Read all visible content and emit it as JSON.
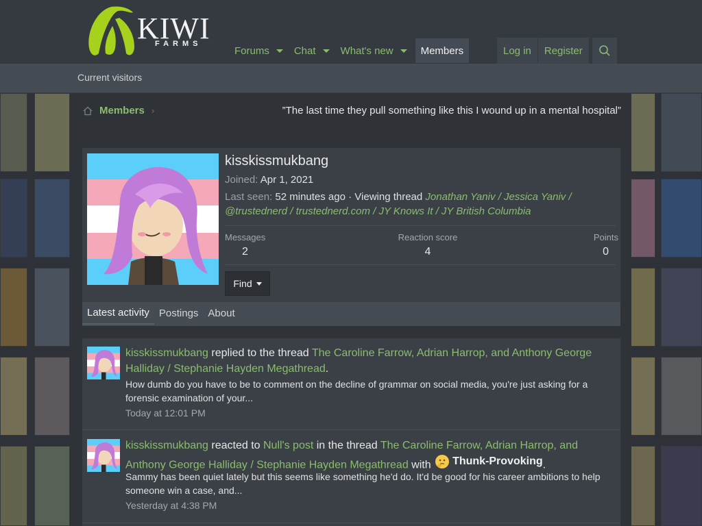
{
  "header": {
    "logo_word": "KIWI",
    "logo_sub": "FARMS",
    "nav": [
      {
        "label": "Forums",
        "dropdown": true
      },
      {
        "label": "Chat",
        "dropdown": true
      },
      {
        "label": "What's new",
        "dropdown": true
      },
      {
        "label": "Members",
        "dropdown": false,
        "active": true
      }
    ],
    "login_label": "Log in",
    "register_label": "Register",
    "search_icon": "search-icon"
  },
  "subnav": {
    "current_visitors": "Current visitors"
  },
  "breadcrumb": {
    "home_icon": "home-icon",
    "members": "Members"
  },
  "quote": "”The last time they pull something like this I wound up in a mental hospital”",
  "profile": {
    "username": "kisskissmukbang",
    "joined_label": "Joined:",
    "joined_value": "Apr 1, 2021",
    "last_seen_label": "Last seen:",
    "last_seen_value": "52 minutes ago · Viewing thread",
    "viewing_thread": "Jonathan Yaniv / Jessica Yaniv / @trustednerd / trustednerd.com / JY Knows It / JY British Columbia",
    "stats": [
      {
        "label": "Messages",
        "value": "2"
      },
      {
        "label": "Reaction score",
        "value": "4"
      },
      {
        "label": "Points",
        "value": "0"
      }
    ],
    "find_label": "Find",
    "tabs": [
      {
        "label": "Latest activity",
        "active": true
      },
      {
        "label": "Postings"
      },
      {
        "label": "About"
      }
    ]
  },
  "activity": [
    {
      "user": "kisskissmukbang",
      "verb": " replied to the thread ",
      "thread": "The Caroline Farrow, Adrian Harrop, and Anthony George Halliday / Stephanie Hayden Megathread",
      "end": ".",
      "snippet": "How dumb do you have to be to comment on the decline of grammar on social media, you're just asking for a forensic examination of your...",
      "time": "Today at 12:01 PM"
    },
    {
      "user": "kisskissmukbang",
      "verb": " reacted to ",
      "post": "Null's post",
      "mid": " in the thread ",
      "thread": "The Caroline Farrow, Adrian Harrop, and Anthony George Halliday / Stephanie Hayden Megathread",
      "with": " with ",
      "reaction": "Thunk-Provoking",
      "reaction_icon": "thinking-face-icon",
      "end": ".",
      "snippet": "Sammy has been quiet lately but this seems like something he'd do. It'd be good for his career ambitions to help someone win a case, and...",
      "time": "Yesterday at 4:38 PM"
    }
  ],
  "colors": {
    "accent_green": "#8abd6e",
    "header_bg": "#353a41",
    "card_bg": "#3b4047",
    "trans_blue": "#5bcefa",
    "trans_pink": "#f5a9b8",
    "hair_purple": "#c07ad8"
  }
}
